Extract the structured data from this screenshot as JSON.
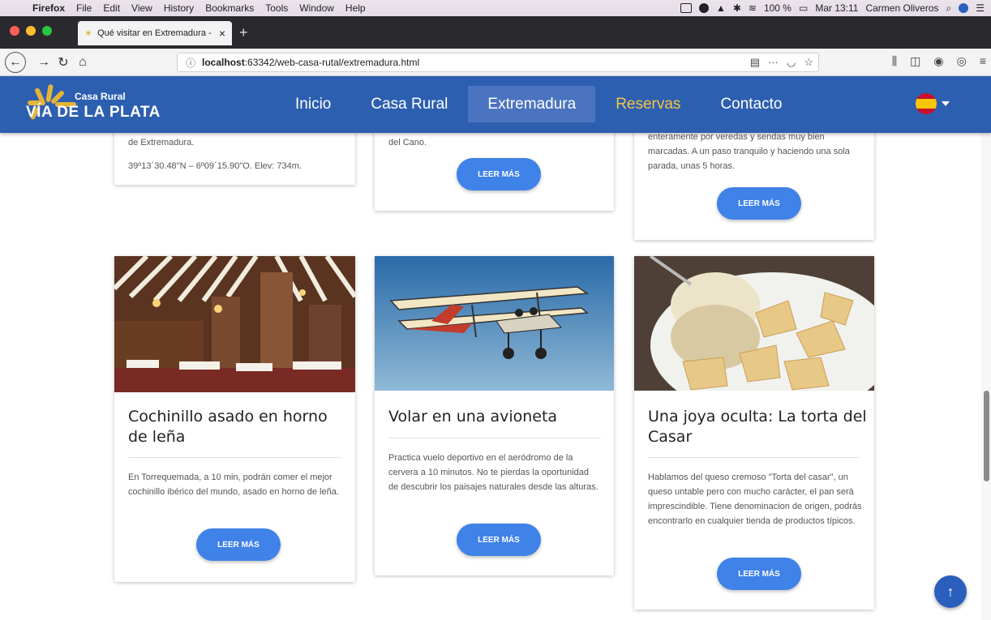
{
  "macos_menubar": {
    "app": "Firefox",
    "items": [
      "File",
      "Edit",
      "View",
      "History",
      "Bookmarks",
      "Tools",
      "Window",
      "Help"
    ],
    "battery": "100 %",
    "clock": "Mar 13:11",
    "user": "Carmen Oliveros"
  },
  "browser": {
    "tab_title": "Qué visitar en Extremadura - Ca",
    "url_host": "localhost",
    "url_rest": ":63342/web-casa-rutal/extremadura.html"
  },
  "site": {
    "logo_sub": "Casa Rural",
    "logo_main": "VÍA DE LA PLATA",
    "nav": [
      "Inicio",
      "Casa Rural",
      "Extremadura",
      "Reservas",
      "Contacto"
    ],
    "active_nav": "Extremadura",
    "highlight_nav": "Reservas",
    "flag": "spain-flag-icon"
  },
  "top_cards": {
    "card1_line1": "de Extremadura.",
    "card1_coords": "39º13´30.48\"N – 6º09´15.90\"O. Elev: 734m.",
    "card2_line1": "del Cano.",
    "card3_lines": [
      "enteramente por veredas y sendas muy bien",
      "marcadas. A un paso tranquilo y haciendo una sola",
      "parada, unas 5 horas."
    ]
  },
  "cards": [
    {
      "title": "Cochinillo asado en horno de leña",
      "text": "En Torrequemada, a 10 min, podrán comer el mejor cochinillo ibérico del mundo,  asado en horno de leña.",
      "image": "restaurant-interior-image"
    },
    {
      "title": "Volar en una avioneta",
      "text": "Practica vuelo deportivo en el aeródromo de la cervera a 10 minutos. No te pierdas la oportunidad de descubrir los paisajes naturales desde las alturas.",
      "image": "ultralight-plane-image"
    },
    {
      "title": "Una joya oculta: La torta del Casar",
      "text": "Hablamos del queso cremoso \"Torta del casar\", un queso untable pero con mucho carácter, el pan será imprescindible. Tiene denominacion de origen, podrás encontrarlo en cualquier tienda de productos típicos.",
      "image": "torta-del-casar-cheese-image"
    }
  ],
  "button_label": "LEER MÁS",
  "colors": {
    "header": "#2d5fb1",
    "button": "#3f82e8",
    "reservas": "#f5c542"
  }
}
